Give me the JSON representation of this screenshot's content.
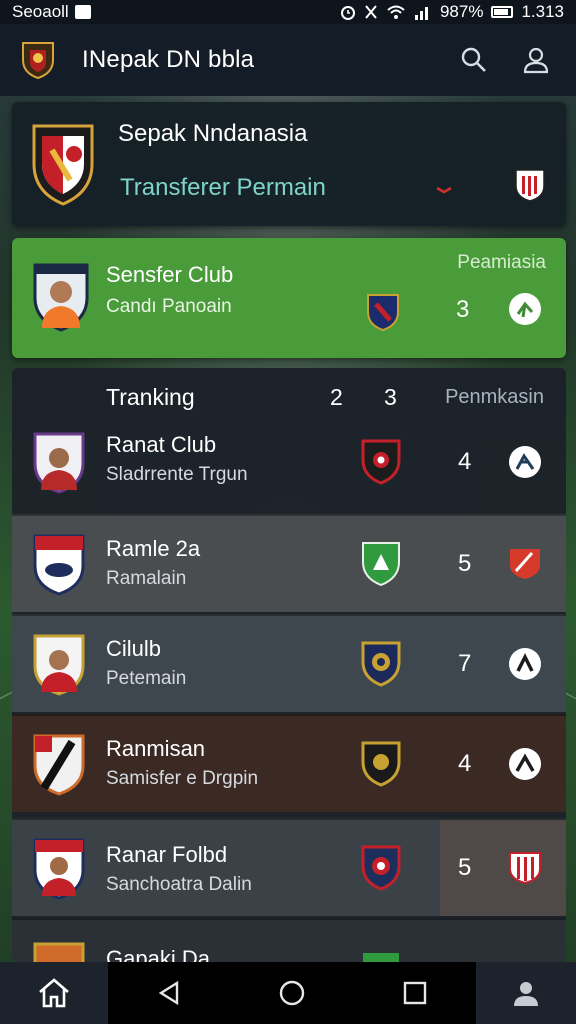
{
  "status_bar": {
    "left_text": "Seoaoll",
    "right_text": "987%",
    "time": "1.313"
  },
  "app_bar": {
    "title": "INepak DN bbla"
  },
  "hero": {
    "title": "Sepak Nndanasia",
    "subtitle": "Transferer Permain"
  },
  "featured": {
    "name": "Sensfer Club",
    "subtitle": "Candı Panoain",
    "header": "Peamiasia",
    "number": "3"
  },
  "ranking": {
    "label": "Tranking",
    "col1": "2",
    "col2": "3",
    "header_right": "Penmkasin",
    "rows": [
      {
        "name": "Ranat Club",
        "subtitle": "Sladrrente Trgun",
        "number": "4"
      },
      {
        "name": "Ramle 2a",
        "subtitle": "Ramalain",
        "number": "5"
      },
      {
        "name": "Cilulb",
        "subtitle": "Petemain",
        "number": "7"
      },
      {
        "name": "Ranmisan",
        "subtitle": "Samisfer e Drgpin",
        "number": "4"
      },
      {
        "name": "Ranar Folbd",
        "subtitle": "Sanchoatra Dalin",
        "number": "5"
      },
      {
        "name": "Gapaki Da",
        "subtitle": "",
        "number": ""
      }
    ]
  },
  "colors": {
    "featured_green": "#4a9b3a",
    "row_bg_1": "#2c3034",
    "row_bg_2": "#4a4d50",
    "row_bg_3": "#3e474d",
    "row_bg_4": "#3b2a24",
    "row_bg_5": "#3b4247"
  }
}
